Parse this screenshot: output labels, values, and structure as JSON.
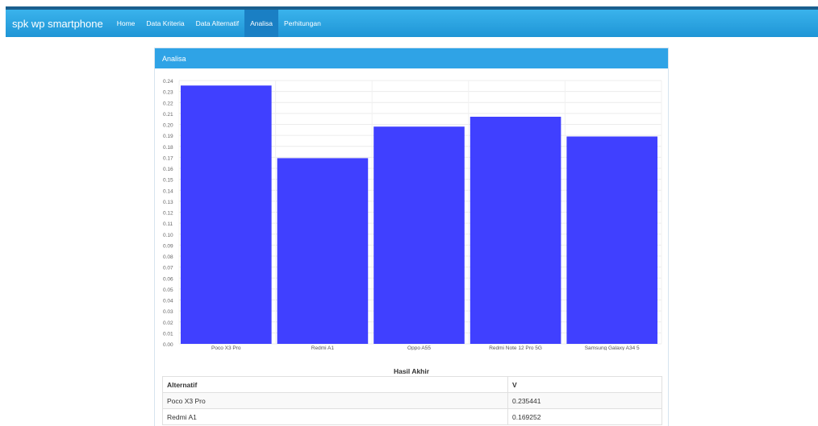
{
  "navbar": {
    "brand": "spk wp smartphone",
    "items": [
      {
        "label": "Home",
        "active": false
      },
      {
        "label": "Data Kriteria",
        "active": false
      },
      {
        "label": "Data Alternatif",
        "active": false
      },
      {
        "label": "Analisa",
        "active": true
      },
      {
        "label": "Perhitungan",
        "active": false
      }
    ]
  },
  "panel": {
    "title": "Analisa"
  },
  "chart_data": {
    "type": "bar",
    "title": "",
    "xlabel": "",
    "ylabel": "",
    "categories": [
      "Poco X3 Pro",
      "Redmi A1",
      "Oppo A55",
      "Redmi Note 12 Pro 5G",
      "Samsung Galaxy A34 5"
    ],
    "values": [
      0.235441,
      0.169252,
      0.198,
      0.207,
      0.189
    ],
    "ylim": [
      0,
      0.24
    ],
    "yticks": [
      "0.00",
      "0.01",
      "0.02",
      "0.03",
      "0.04",
      "0.05",
      "0.06",
      "0.07",
      "0.08",
      "0.09",
      "0.10",
      "0.11",
      "0.12",
      "0.13",
      "0.14",
      "0.15",
      "0.16",
      "0.17",
      "0.18",
      "0.19",
      "0.20",
      "0.21",
      "0.22",
      "0.23",
      "0.24"
    ],
    "grid": true,
    "bar_color": "#4040ff"
  },
  "result": {
    "title": "Hasil Akhir",
    "headers": [
      "Alternatif",
      "V"
    ],
    "rows": [
      [
        "Poco X3 Pro",
        "0.235441"
      ],
      [
        "Redmi A1",
        "0.169252"
      ]
    ]
  }
}
